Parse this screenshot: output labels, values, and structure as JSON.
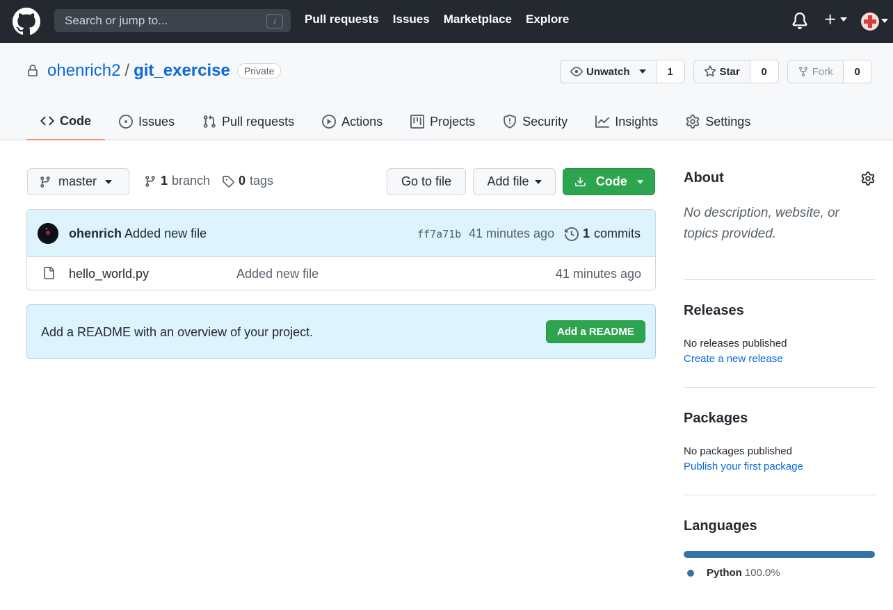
{
  "header": {
    "search_placeholder": "Search or jump to...",
    "search_shortcut": "/",
    "nav": [
      "Pull requests",
      "Issues",
      "Marketplace",
      "Explore"
    ]
  },
  "repo": {
    "owner": "ohenrich2",
    "separator": "/",
    "name": "git_exercise",
    "visibility": "Private",
    "watch_label": "Unwatch",
    "watch_count": "1",
    "star_label": "Star",
    "star_count": "0",
    "fork_label": "Fork",
    "fork_count": "0"
  },
  "tabs": [
    {
      "label": "Code",
      "icon": "code-icon"
    },
    {
      "label": "Issues",
      "icon": "issue-icon"
    },
    {
      "label": "Pull requests",
      "icon": "pull-request-icon"
    },
    {
      "label": "Actions",
      "icon": "play-icon"
    },
    {
      "label": "Projects",
      "icon": "project-icon"
    },
    {
      "label": "Security",
      "icon": "shield-icon"
    },
    {
      "label": "Insights",
      "icon": "graph-icon"
    },
    {
      "label": "Settings",
      "icon": "gear-icon"
    }
  ],
  "toolbar": {
    "branch": "master",
    "branch_count": "1",
    "branch_label": "branch",
    "tag_count": "0",
    "tag_label": "tags",
    "go_to_file": "Go to file",
    "add_file": "Add file",
    "code": "Code"
  },
  "latest_commit": {
    "author": "ohenrich",
    "message": "Added new file",
    "sha": "ff7a71b",
    "time": "41 minutes ago",
    "commit_count": "1",
    "commit_label": "commits"
  },
  "files": [
    {
      "name": "hello_world.py",
      "message": "Added new file",
      "time": "41 minutes ago"
    }
  ],
  "readme_banner": {
    "text": "Add a README with an overview of your project.",
    "button": "Add a README"
  },
  "sidebar": {
    "about_title": "About",
    "about_desc": "No description, website, or topics provided.",
    "releases_title": "Releases",
    "releases_text": "No releases published",
    "releases_link": "Create a new release",
    "packages_title": "Packages",
    "packages_text": "No packages published",
    "packages_link": "Publish your first package",
    "languages_title": "Languages",
    "languages": [
      {
        "name": "Python",
        "percent": "100.0%",
        "color": "#3572a5"
      }
    ]
  },
  "colors": {
    "header_bg": "#24292f",
    "link": "#0969da",
    "green": "#2da44e",
    "active_tab_underline": "#fd8c73",
    "python": "#3572a5"
  }
}
